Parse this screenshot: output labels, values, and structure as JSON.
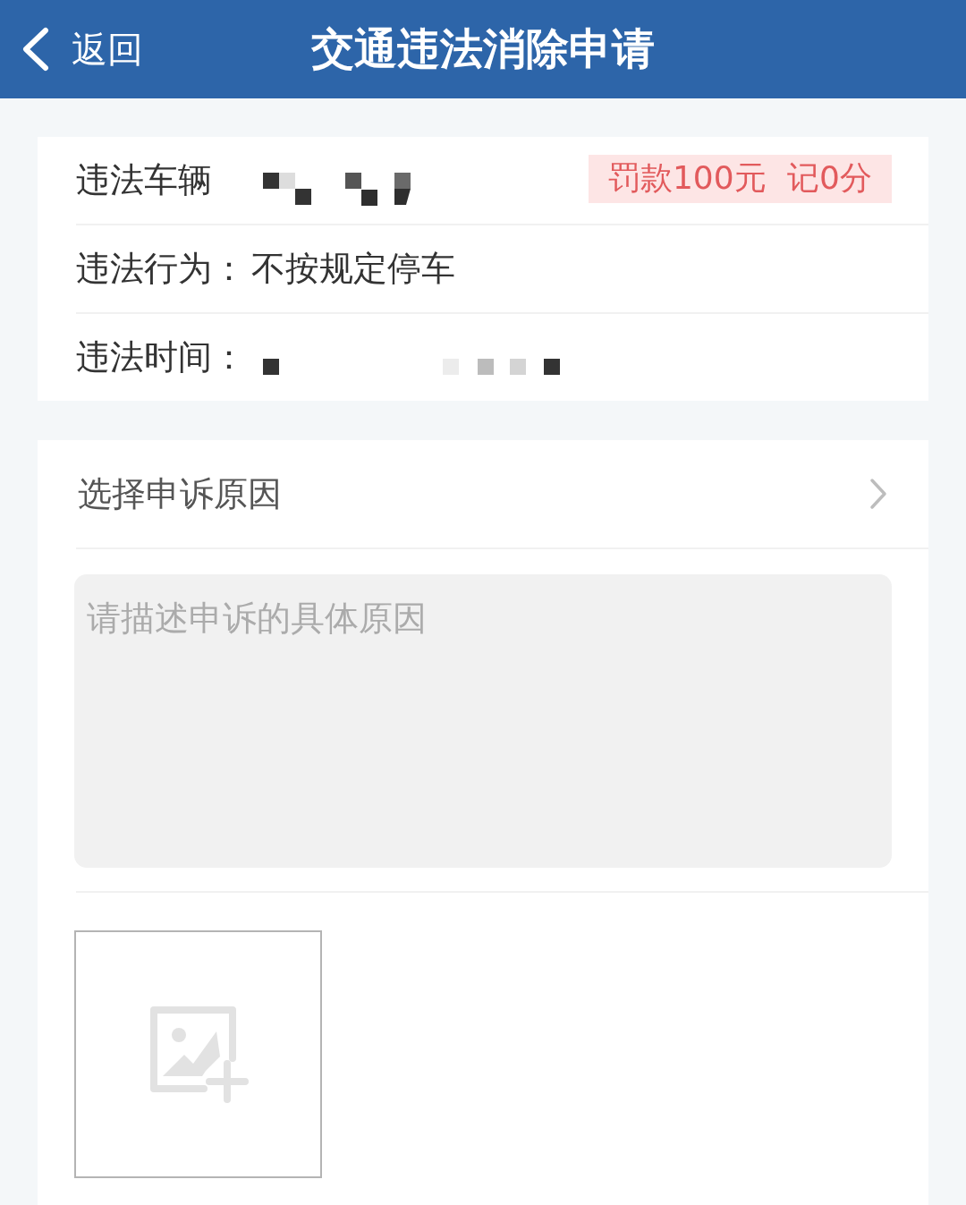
{
  "header": {
    "back_label": "返回",
    "title": "交通违法消除申请"
  },
  "violation": {
    "rows": [
      {
        "kind": "redacted",
        "label": "违法车辆",
        "badge": "罚款100元 记0分"
      },
      {
        "kind": "text",
        "label": "违法行为：",
        "value": "不按规定停车"
      },
      {
        "kind": "redacted",
        "label": "违法时间："
      }
    ]
  },
  "appeal": {
    "reason_picker": {
      "label": "选择申诉原因"
    },
    "description": {
      "placeholder": "请描述申诉的具体原因"
    }
  }
}
